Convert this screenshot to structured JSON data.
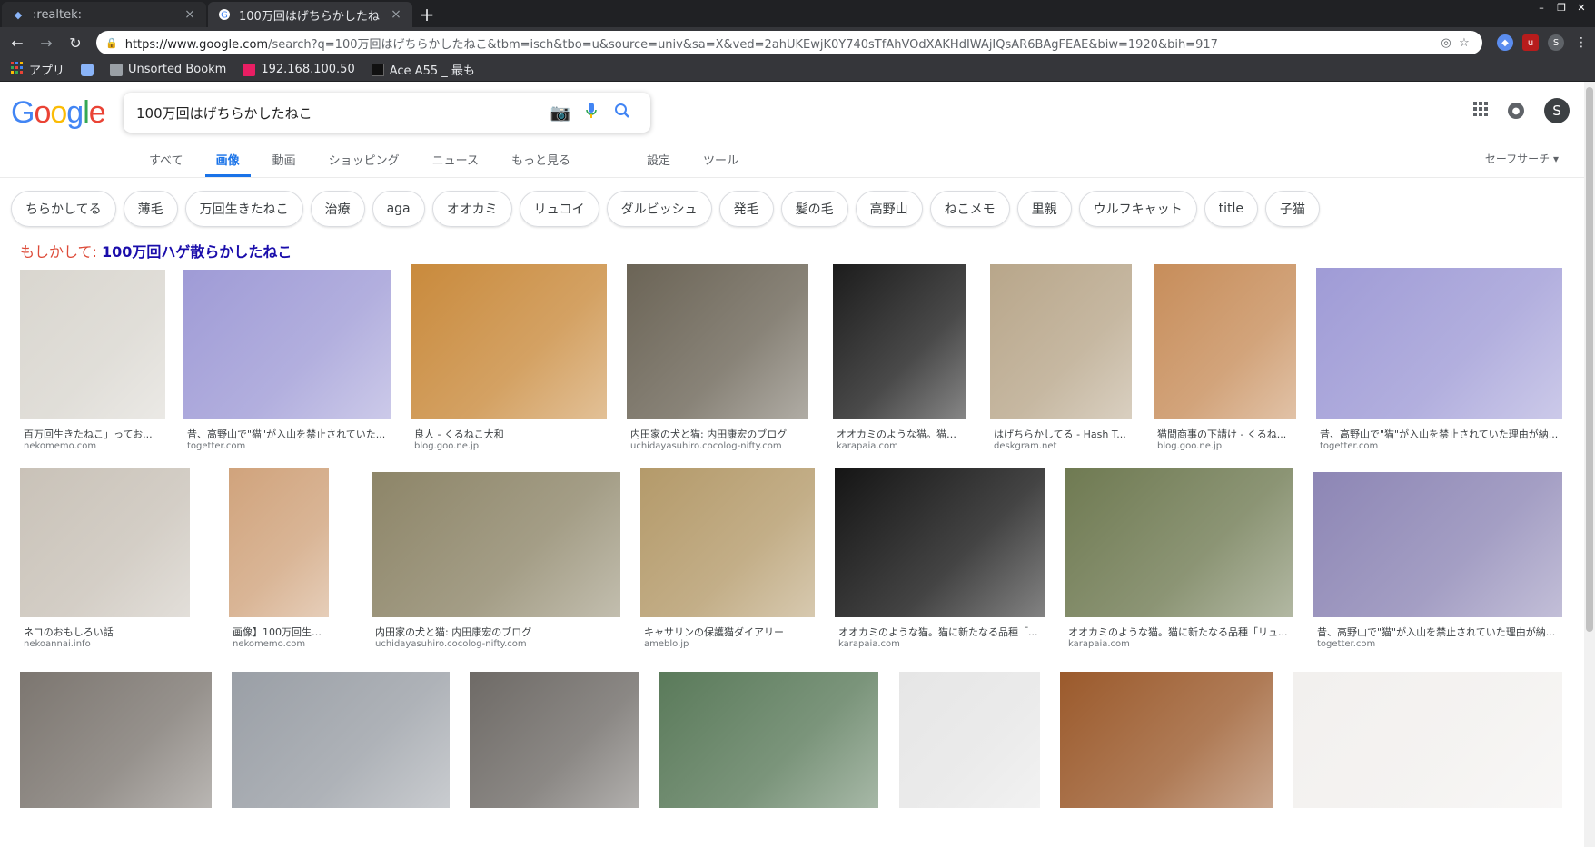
{
  "tabs": [
    {
      "title": ":realtek:",
      "close": "×"
    },
    {
      "title": "100万回はげちらかしたね",
      "close": "×"
    }
  ],
  "new_tab": "+",
  "window_controls": [
    "–",
    "❐",
    "✕"
  ],
  "url": {
    "host": "https://www.google.com",
    "path": "/search?q=100万回はげちらかしたねこ&tbm=isch&tbo=u&source=univ&sa=X&ved=2ahUKEwjK0Y740sTfAhVOdXAKHdIWAjIQsAR6BAgFEAE&biw=1920&bih=917"
  },
  "bookmarks": [
    {
      "label": "アプリ",
      "color": "#ea4335"
    },
    {
      "label": "",
      "color": "#8ab4f8"
    },
    {
      "label": "Unsorted Bookm",
      "color": "#9aa0a6"
    },
    {
      "label": "192.168.100.50",
      "color": "#e91e63"
    },
    {
      "label": "Ace A55 _ 最も",
      "color": "#222222"
    }
  ],
  "search": {
    "query": "100万回はげちらかしたねこ"
  },
  "account_initial": "S",
  "nav_tabs": [
    "すべて",
    "画像",
    "動画",
    "ショッピング",
    "ニュース",
    "もっと見る",
    "設定",
    "ツール"
  ],
  "active_nav": "画像",
  "safesearch": "セーフサーチ ▾",
  "chips": [
    "ちらかしてる",
    "薄毛",
    "万回生きたねこ",
    "治療",
    "aga",
    "オオカミ",
    "リュコイ",
    "ダルビッシュ",
    "発毛",
    "髪の毛",
    "高野山",
    "ねこメモ",
    "里親",
    "ウルフキャット",
    "title",
    "子猫"
  ],
  "did_you_mean": {
    "prefix": "もしかして:",
    "suggestion": "100万回ハゲ散らかしたねこ"
  },
  "results": [
    {
      "caption": "百万回生きたねこ」ってお...",
      "source": "nekomemo.com",
      "color": "#d9d6cf"
    },
    {
      "caption": "昔、高野山で\"猫\"が入山を禁止されていた...",
      "source": "togetter.com",
      "color": "#9f9bd6"
    },
    {
      "caption": "良人 - くるねこ大和",
      "source": "blog.goo.ne.jp",
      "color": "#c98a3c"
    },
    {
      "caption": "内田家の犬と猫: 内田康宏のブログ",
      "source": "uchidayasuhiro.cocolog-nifty.com",
      "color": "#6b6456"
    },
    {
      "caption": "オオカミのような猫。猫に...",
      "source": "karapaia.com",
      "color": "#1c1c1c"
    },
    {
      "caption": "はげちらかしてる - Hash T...",
      "source": "deskgram.net",
      "color": "#b8a68a"
    },
    {
      "caption": "猫間商事の下請け - くるね...",
      "source": "blog.goo.ne.jp",
      "color": "#c78d5a"
    },
    {
      "caption": "昔、高野山で\"猫\"が入山を禁止されていた理由が納...",
      "source": "togetter.com",
      "color": "#9f9bd6"
    },
    {
      "caption": "ネコのおもしろい話",
      "source": "nekoannai.info",
      "color": "#c9c2b8"
    },
    {
      "caption": "画像】100万回生きたねこ...",
      "source": "nekomemo.com",
      "color": "#d0a37c"
    },
    {
      "caption": "内田家の犬と猫: 内田康宏のブログ",
      "source": "uchidayasuhiro.cocolog-nifty.com",
      "color": "#8d8568"
    },
    {
      "caption": "キャサリンの保護猫ダイアリー",
      "source": "ameblo.jp",
      "color": "#b49a6a"
    },
    {
      "caption": "オオカミのような猫。猫に新たなる品種「...",
      "source": "karapaia.com",
      "color": "#151515"
    },
    {
      "caption": "オオカミのような猫。猫に新たなる品種「リュ...",
      "source": "karapaia.com",
      "color": "#6f7a52"
    },
    {
      "caption": "昔、高野山で\"猫\"が入山を禁止されていた理由が納...",
      "source": "togetter.com",
      "color": "#8d86b5"
    },
    {
      "caption": "",
      "source": "",
      "color": "#7c7670"
    },
    {
      "caption": "",
      "source": "",
      "color": "#9a9fa6"
    },
    {
      "caption": "",
      "source": "",
      "color": "#6e6a66"
    },
    {
      "caption": "",
      "source": "",
      "color": "#5a7a5a"
    },
    {
      "caption": "",
      "source": "",
      "color": "#e6e6e6"
    },
    {
      "caption": "",
      "source": "",
      "color": "#9b5a2c"
    },
    {
      "caption": "",
      "source": "",
      "color": "#f2f0ee"
    }
  ]
}
